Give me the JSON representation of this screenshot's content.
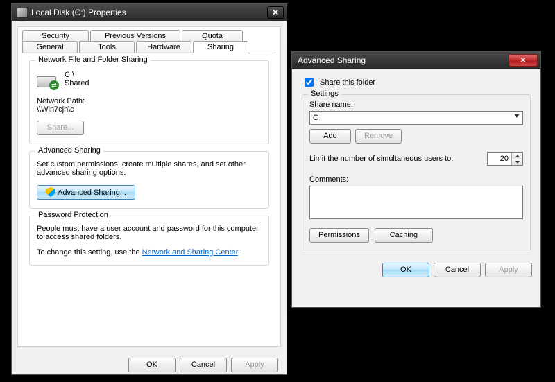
{
  "props": {
    "title": "Local Disk (C:) Properties",
    "tabs_row1": [
      {
        "key": "security",
        "label": "Security"
      },
      {
        "key": "prev",
        "label": "Previous Versions"
      },
      {
        "key": "quota",
        "label": "Quota"
      }
    ],
    "tabs_row2": [
      {
        "key": "general",
        "label": "General"
      },
      {
        "key": "tools",
        "label": "Tools"
      },
      {
        "key": "hardware",
        "label": "Hardware"
      },
      {
        "key": "sharing",
        "label": "Sharing"
      }
    ],
    "active_tab": "sharing",
    "network_group": {
      "title": "Network File and Folder Sharing",
      "path_line1": "C:\\",
      "path_line2": "Shared",
      "netpath_label": "Network Path:",
      "netpath_value": "\\\\Win7cjh\\c",
      "share_btn": "Share..."
    },
    "adv_group": {
      "title": "Advanced Sharing",
      "desc": "Set custom permissions, create multiple shares, and set other advanced sharing options.",
      "btn": "Advanced Sharing..."
    },
    "pw_group": {
      "title": "Password Protection",
      "line1": "People must have a user account and password for this computer to access shared folders.",
      "line2_prefix": "To change this setting, use the ",
      "link": "Network and Sharing Center",
      "line2_suffix": "."
    },
    "buttons": {
      "ok": "OK",
      "cancel": "Cancel",
      "apply": "Apply"
    }
  },
  "adv": {
    "title": "Advanced Sharing",
    "share_folder": {
      "label": "Share this folder",
      "checked": true
    },
    "settings_title": "Settings",
    "share_name_label": "Share name:",
    "share_name_value": "C",
    "add_btn": "Add",
    "remove_btn": "Remove",
    "limit_label": "Limit the number of simultaneous users to:",
    "limit_value": "20",
    "comments_label": "Comments:",
    "comments_value": "",
    "permissions_btn": "Permissions",
    "caching_btn": "Caching",
    "ok": "OK",
    "cancel": "Cancel",
    "apply": "Apply"
  }
}
